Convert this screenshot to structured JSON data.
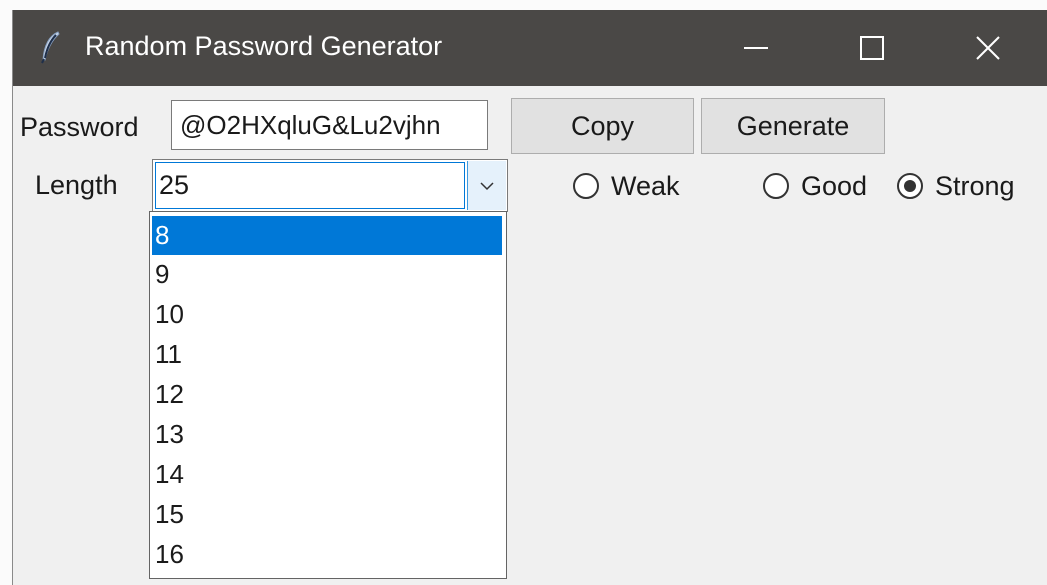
{
  "window": {
    "title": "Random Password Generator",
    "icon": "feather-icon",
    "controls": [
      "minimize-icon",
      "maximize-icon",
      "close-icon"
    ]
  },
  "password": {
    "label": "Password",
    "value": "@O2HXqluG&Lu2vjhn",
    "copy_label": "Copy",
    "generate_label": "Generate"
  },
  "length": {
    "label": "Length",
    "value": "25",
    "options": [
      "8",
      "9",
      "10",
      "11",
      "12",
      "13",
      "14",
      "15",
      "16"
    ],
    "highlighted": "8"
  },
  "strength": {
    "options": [
      {
        "label": "Weak",
        "checked": false
      },
      {
        "label": "Good",
        "checked": false
      },
      {
        "label": "Strong",
        "checked": true
      }
    ]
  },
  "colors": {
    "titlebar": "#4a4846",
    "selection": "#0078d7",
    "button": "#e1e1e1"
  }
}
